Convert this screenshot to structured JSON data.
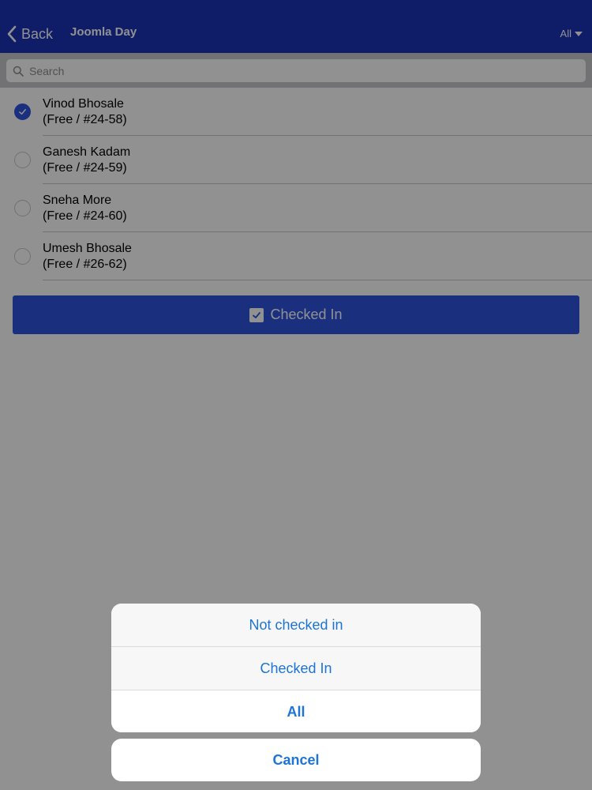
{
  "header": {
    "back_label": "Back",
    "title": "Joomla Day",
    "filter_label": "All"
  },
  "search": {
    "placeholder": "Search"
  },
  "attendees": [
    {
      "name": "Vinod Bhosale",
      "detail": "(Free / #24-58)",
      "checked": true
    },
    {
      "name": "Ganesh Kadam",
      "detail": "(Free / #24-59)",
      "checked": false
    },
    {
      "name": "Sneha More",
      "detail": "(Free / #24-60)",
      "checked": false
    },
    {
      "name": "Umesh Bhosale",
      "detail": "(Free / #26-62)",
      "checked": false
    }
  ],
  "checkin_button": {
    "label": "Checked In"
  },
  "action_sheet": {
    "options": [
      {
        "label": "Not checked in"
      },
      {
        "label": "Checked In"
      },
      {
        "label": "All"
      }
    ],
    "cancel_label": "Cancel"
  },
  "colors": {
    "header_bg": "#1b32b8",
    "primary": "#2f55e0",
    "action_text": "#1d74d8"
  }
}
